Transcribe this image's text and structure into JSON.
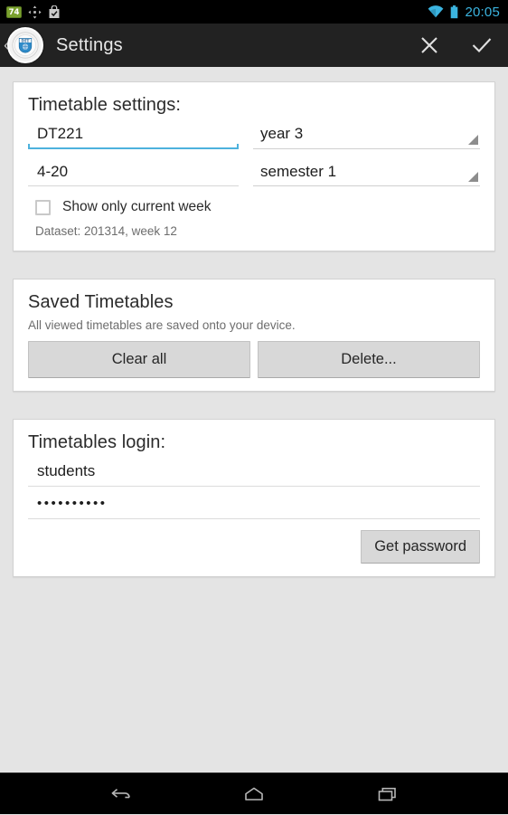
{
  "status_bar": {
    "icons": [
      "notification-count-badge",
      "sync-move-icon",
      "play-store-bag-icon"
    ],
    "badge_count": "74",
    "wifi_icon": "wifi-icon",
    "battery_icon": "battery-icon",
    "time": "20:05",
    "time_color": "#3bb4e0",
    "background": "#000000"
  },
  "action_bar": {
    "back_chevron": "‹",
    "logo_text": "DIT",
    "logo_name": "dit-shield-logo",
    "title": "Settings",
    "discard_label": "close-icon",
    "confirm_label": "check-icon",
    "background": "#222222"
  },
  "cards": {
    "timetable_settings": {
      "title": "Timetable settings:",
      "course_value": "DT221",
      "course_focused": true,
      "year_value": "year 3",
      "group_value": "4-20",
      "semester_value": "semester 1",
      "checkbox_label": "Show only current week",
      "checkbox_checked": false,
      "dataset_text": "Dataset: 201314, week 12",
      "focus_color": "#4db2dd"
    },
    "saved_timetables": {
      "title": "Saved Timetables",
      "subtitle": "All viewed timetables are saved onto your device.",
      "clear_all_label": "Clear all",
      "delete_label": "Delete..."
    },
    "timetables_login": {
      "title": "Timetables login:",
      "username_value": "students",
      "password_value": "••••••••••",
      "get_password_label": "Get password"
    }
  },
  "nav_bar": {
    "back": "back-icon",
    "home": "home-icon",
    "recents": "recents-icon",
    "background": "#000000"
  },
  "theme": {
    "page_background": "#e4e4e4",
    "card_background": "#ffffff",
    "button_background": "#d8d8d8"
  }
}
